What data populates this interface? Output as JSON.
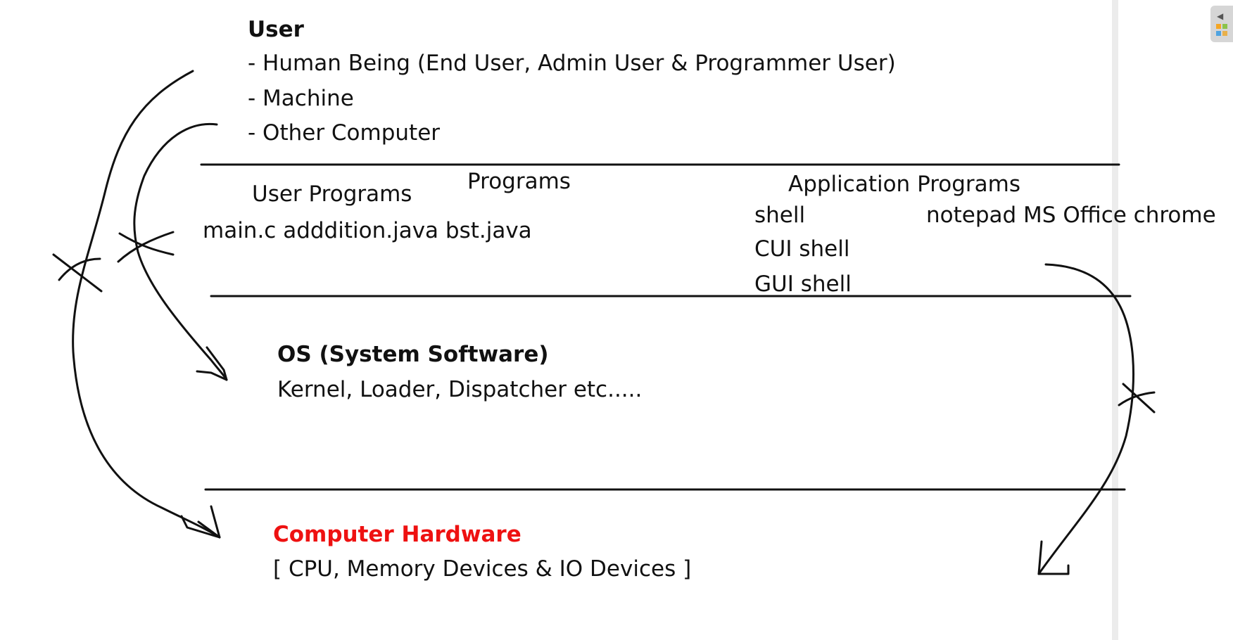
{
  "user_section": {
    "heading": "User",
    "items": [
      "- Human Being (End User, Admin User & Programmer User)",
      "- Machine",
      "- Other Computer"
    ]
  },
  "programs_section": {
    "programs_label": "Programs",
    "user_programs_label": "User Programs",
    "user_programs_files": "main.c adddition.java bst.java",
    "application_programs_label": "Application Programs",
    "shell": "shell",
    "cui_shell": "CUI shell",
    "gui_shell": "GUI shell",
    "apps": "notepad MS Office chrome"
  },
  "os_section": {
    "heading": "OS (System Software)",
    "detail": "Kernel, Loader, Dispatcher etc....."
  },
  "hardware_section": {
    "heading": "Computer Hardware",
    "detail": "[ CPU, Memory Devices & IO Devices ]",
    "heading_color": "#ee1111"
  },
  "colors": {
    "ink": "#111111",
    "accent": "#ee1111"
  }
}
